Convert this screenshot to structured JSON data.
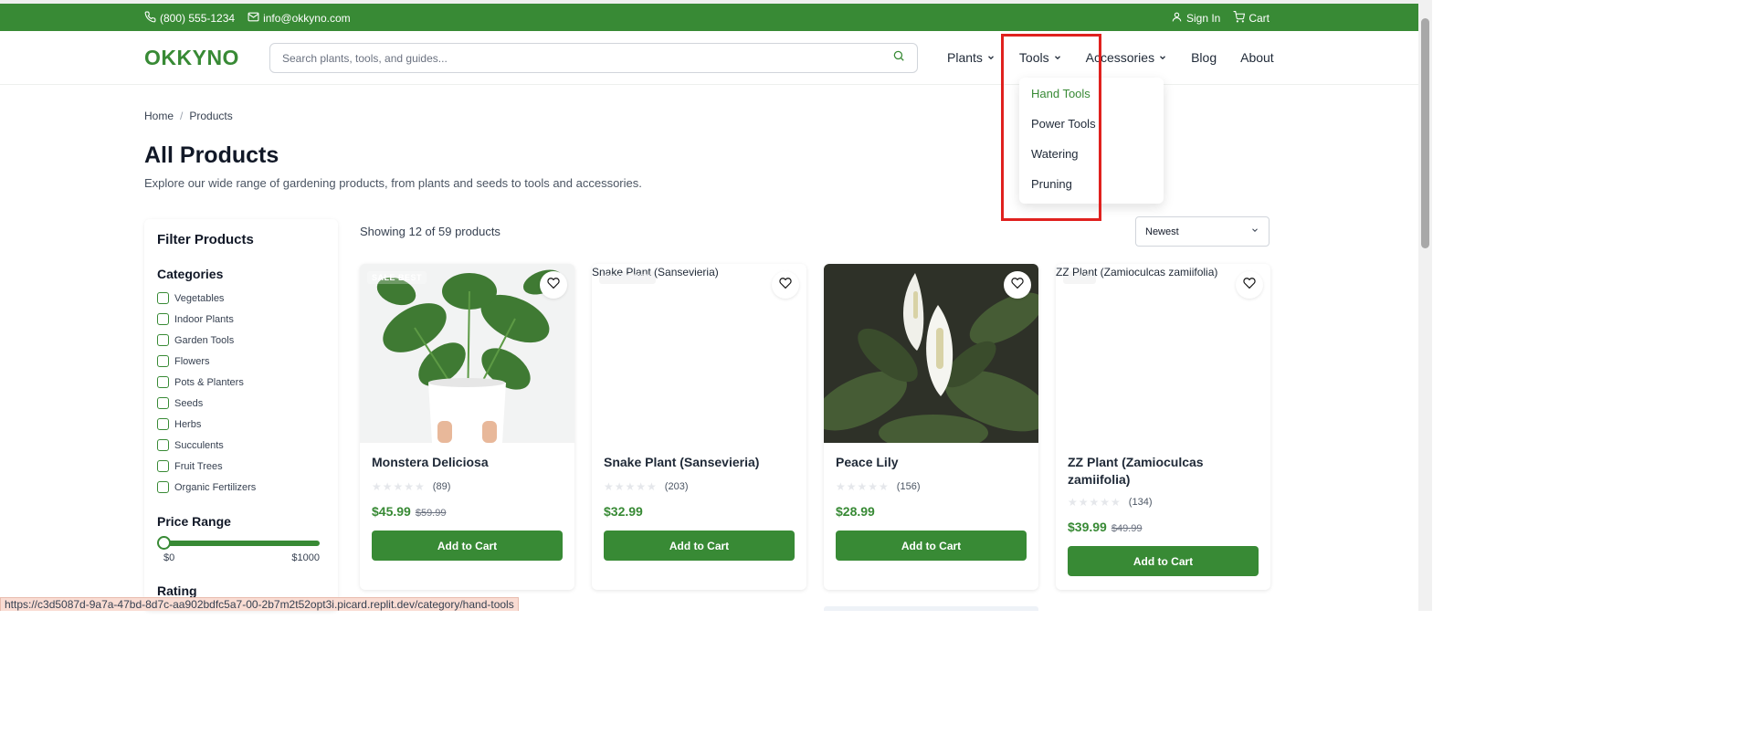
{
  "topbar": {
    "phone": "(800) 555-1234",
    "email": "info@okkyno.com",
    "sign_in": "Sign In",
    "cart": "Cart"
  },
  "header": {
    "logo": "OKKYNO",
    "search_placeholder": "Search plants, tools, and guides...",
    "nav": [
      {
        "label": "Plants",
        "dropdown": true
      },
      {
        "label": "Tools",
        "dropdown": true
      },
      {
        "label": "Accessories",
        "dropdown": true
      },
      {
        "label": "Blog",
        "dropdown": false
      },
      {
        "label": "About",
        "dropdown": false
      }
    ]
  },
  "tools_dropdown": {
    "items": [
      "Hand Tools",
      "Power Tools",
      "Watering",
      "Pruning"
    ],
    "active": "Hand Tools"
  },
  "breadcrumb": {
    "home": "Home",
    "sep": "/",
    "current": "Products"
  },
  "page": {
    "title": "All Products",
    "subtitle": "Explore our wide range of gardening products, from plants and seeds to tools and accessories."
  },
  "filters": {
    "title": "Filter Products",
    "categories_title": "Categories",
    "categories": [
      "Vegetables",
      "Indoor Plants",
      "Garden Tools",
      "Flowers",
      "Pots & Planters",
      "Seeds",
      "Herbs",
      "Succulents",
      "Fruit Trees",
      "Organic Fertilizers"
    ],
    "price_title": "Price Range",
    "price_min": "$0",
    "price_max": "$1000",
    "price_level": 0.0,
    "rating_title": "Rating"
  },
  "listing": {
    "showing": "Showing 12 of 59 products",
    "sort": "Newest"
  },
  "products": [
    {
      "name": "Monstera Deliciosa",
      "reviews": "(89)",
      "price": "$45.99",
      "old_price": "$59.99",
      "badge": "SALE  BEST",
      "button": "Add to Cart",
      "image": "monstera"
    },
    {
      "name": "Snake Plant (Sansevieria)",
      "reviews": "(203)",
      "price": "$32.99",
      "old_price": "",
      "badge": "FEATURED",
      "alt": "Snake Plant (Sansevieria)",
      "button": "Add to Cart",
      "image": "broken"
    },
    {
      "name": "Peace Lily",
      "reviews": "(156)",
      "price": "$28.99",
      "old_price": "",
      "badge": "",
      "button": "Add to Cart",
      "image": "peace-lily"
    },
    {
      "name": "ZZ Plant (Zamioculcas zamiifolia)",
      "reviews": "(134)",
      "price": "$39.99",
      "old_price": "$49.99",
      "badge": "SALE",
      "alt": "ZZ Plant (Zamioculcas zamiifolia)",
      "button": "Add to Cart",
      "image": "broken"
    }
  ],
  "status_url": "https://c3d5087d-9a7a-47bd-8d7c-aa902bdfc5a7-00-2b7m2t52opt3i.picard.replit.dev/category/hand-tools",
  "colors": {
    "brand": "#388a35",
    "highlight": "#e0211e"
  }
}
